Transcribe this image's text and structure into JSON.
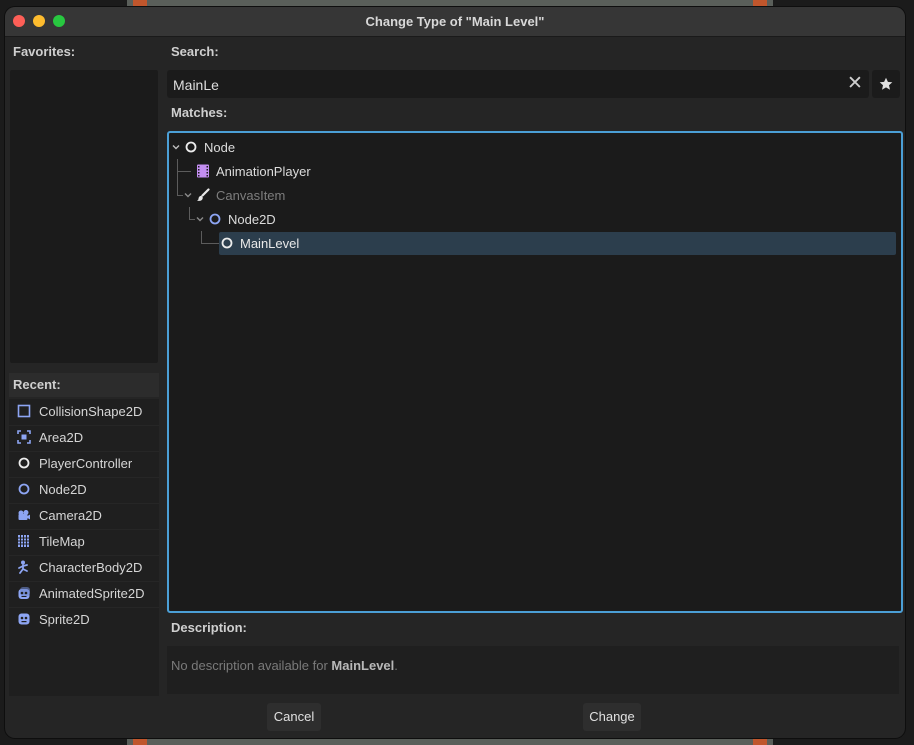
{
  "window": {
    "title": "Change Type of \"Main Level\""
  },
  "favorites": {
    "label": "Favorites:"
  },
  "recent": {
    "label": "Recent:",
    "items": [
      {
        "label": "CollisionShape2D",
        "icon": "collision-shape-icon"
      },
      {
        "label": "Area2D",
        "icon": "area-icon"
      },
      {
        "label": "PlayerController",
        "icon": "node-icon"
      },
      {
        "label": "Node2D",
        "icon": "node2d-icon"
      },
      {
        "label": "Camera2D",
        "icon": "camera-icon"
      },
      {
        "label": "TileMap",
        "icon": "tilemap-icon"
      },
      {
        "label": "CharacterBody2D",
        "icon": "character-body-icon"
      },
      {
        "label": "AnimatedSprite2D",
        "icon": "animated-sprite-icon"
      },
      {
        "label": "Sprite2D",
        "icon": "sprite-icon"
      }
    ]
  },
  "search": {
    "label": "Search:",
    "value": "MainLe"
  },
  "matches": {
    "label": "Matches:",
    "items": [
      {
        "label": "Node",
        "icon": "node-icon"
      },
      {
        "label": "AnimationPlayer",
        "icon": "animation-player-icon"
      },
      {
        "label": "CanvasItem",
        "icon": "canvas-item-icon"
      },
      {
        "label": "Node2D",
        "icon": "node2d-icon"
      },
      {
        "label": "MainLevel",
        "icon": "node-icon",
        "selected": true
      }
    ]
  },
  "description": {
    "label": "Description:",
    "prefix": "No description available for ",
    "name": "MainLevel",
    "suffix": "."
  },
  "buttons": {
    "cancel": "Cancel",
    "change": "Change"
  },
  "colors": {
    "accent": "#4b9fd6",
    "selection": "#2c3e4d",
    "node2d_blue": "#8da5f3",
    "animation_purple": "#c38ef1"
  }
}
